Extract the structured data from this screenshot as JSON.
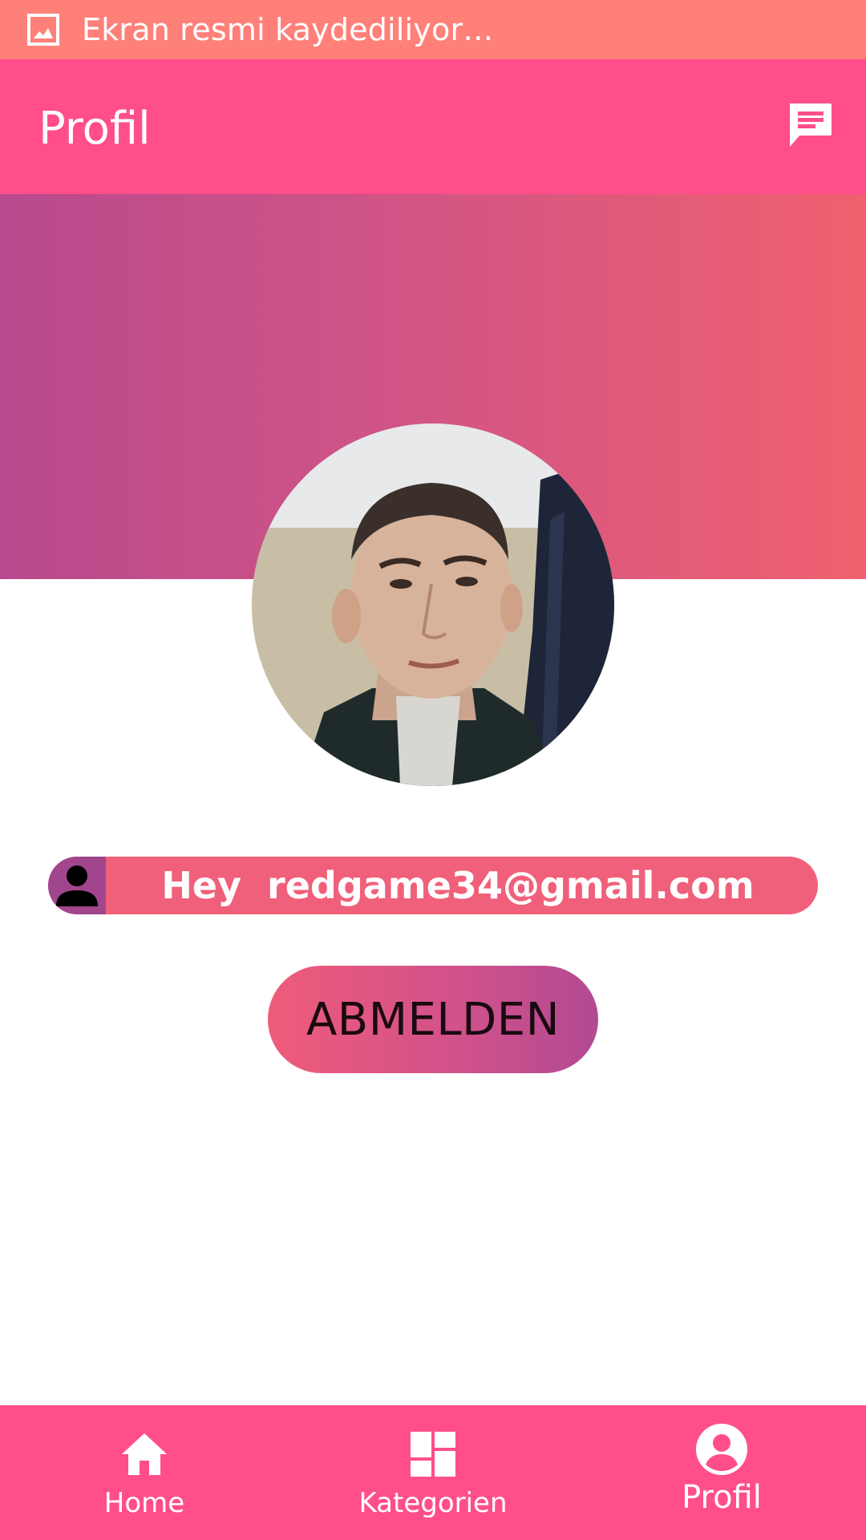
{
  "status_bar": {
    "icon": "image-icon",
    "text": "Ekran resmi kaydediliyor…"
  },
  "app_bar": {
    "title": "Profil",
    "action_icon": "chat-icon"
  },
  "profile": {
    "avatar_icon": "profile-photo",
    "greeting": "Hey  redgame34@gmail.com",
    "person_icon": "person-icon"
  },
  "logout": {
    "label": "ABMELDEN"
  },
  "bottom_nav": {
    "items": [
      {
        "label": "Home",
        "icon": "home-icon",
        "active": false
      },
      {
        "label": "Kategorien",
        "icon": "dashboard-icon",
        "active": false
      },
      {
        "label": "Profil",
        "icon": "account-circle-icon",
        "active": true
      }
    ]
  },
  "colors": {
    "status_bar": "#ff8079",
    "app_bar": "#ff4e8b",
    "banner_start": "#b84a8d",
    "banner_end": "#f0606e",
    "email_pill": "#f0607a",
    "person_box": "#a1468c",
    "bottom_nav": "#ff4e8b"
  }
}
